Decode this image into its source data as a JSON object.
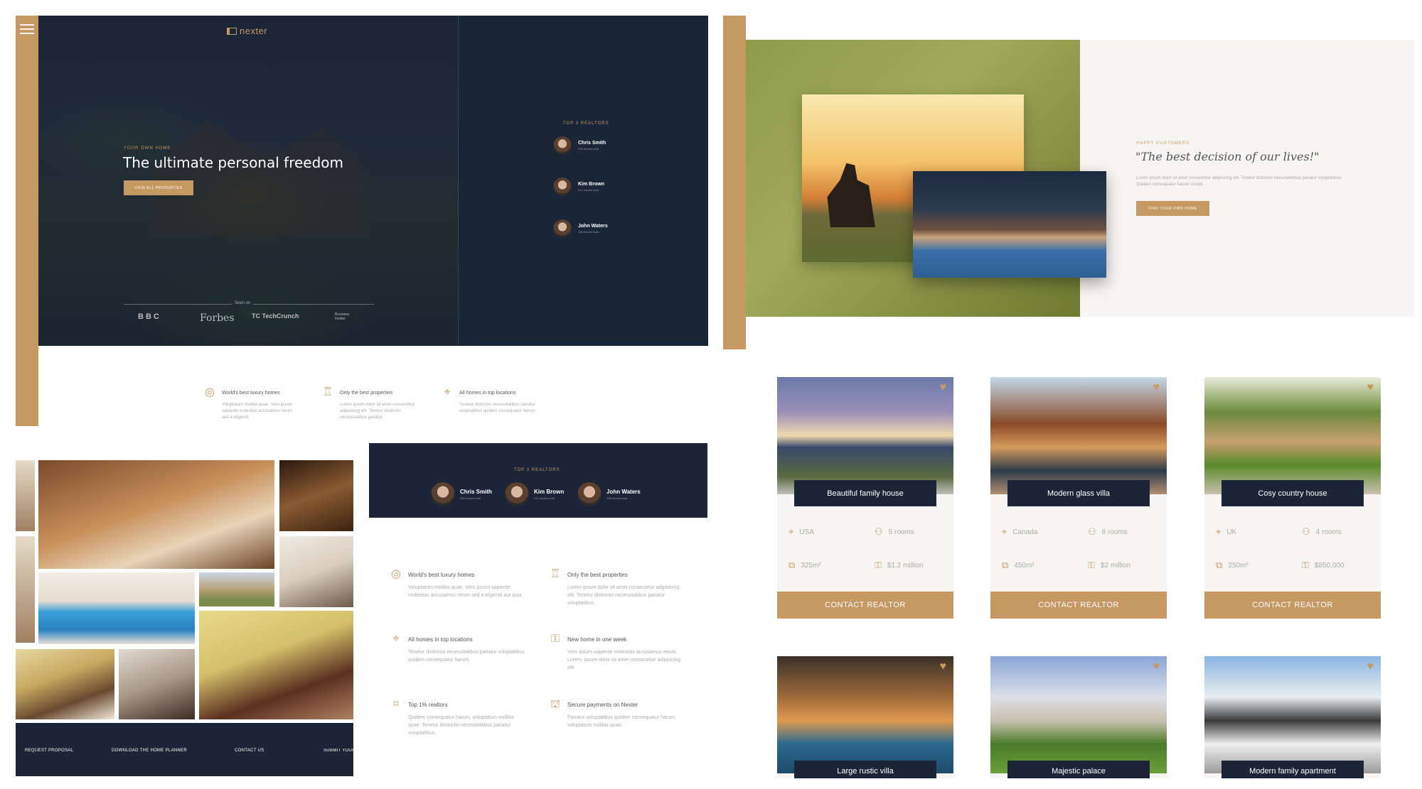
{
  "hero": {
    "logo": "nexter",
    "eyebrow": "Your own home",
    "title": "The ultimate personal freedom",
    "cta": "View all properties",
    "seen_on": "Seen on",
    "brands": [
      "BBC",
      "Forbes",
      "TechCrunch",
      "Business Insider"
    ]
  },
  "realtors": {
    "heading": "Top 3 Realtors",
    "people": [
      {
        "name": "Chris Smith",
        "sub": "245 houses sold"
      },
      {
        "name": "Kim Brown",
        "sub": "212 houses sold"
      },
      {
        "name": "John Waters",
        "sub": "198 houses sold"
      }
    ]
  },
  "features_row": [
    {
      "icon": "globe-icon",
      "title": "World's best luxury homes",
      "text": "Voluptatum mollitia quae. Vero ipsum sapiente molestias accusamus rerum sed a eligendi."
    },
    {
      "icon": "trophy-icon",
      "title": "Only the best properties",
      "text": "Lorem ipsum dolor sit amet consectetur adipisicing elit. Tenetur distinctio necessitatibus pariatur."
    },
    {
      "icon": "map-pin-icon",
      "title": "All homes in top locations",
      "text": "Tenetur distinctio necessitatibus pariatur voluptatibus quidem consequatur harum."
    }
  ],
  "testimonial": {
    "eyebrow": "Happy customers",
    "quote": "\"The best decision of our lives!\"",
    "text": "Lorem ipsum dolor sit amet consectetur adipisicing elit. Tenetur distinctio necessitatibus pariatur voluptatibus. Quidem consequatur harum volupti.",
    "cta": "Find your own home"
  },
  "features_grid": [
    {
      "icon": "globe-icon",
      "title": "World's best luxury homes",
      "text": "Voluptatum mollitia quae. Vero ipsum sapiente molestias accusamus rerum sed a eligendi aut quia."
    },
    {
      "icon": "trophy-icon",
      "title": "Only the best properties",
      "text": "Lorem ipsum dolor sit amet consectetur adipisicing elit. Tenetur distinctio necessitatibus pariatur voluptatibus."
    },
    {
      "icon": "map-pin-icon",
      "title": "All homes in top locations",
      "text": "Tenetur distinctio necessitatibus pariatur voluptatibus quidem consequatur harum."
    },
    {
      "icon": "key-icon",
      "title": "New home in one week",
      "text": "Vero ipsum sapiente molestias accusamus rerum. Lorem, ipsum dolor sit amet consectetur adipisicing elit."
    },
    {
      "icon": "chart-icon",
      "title": "Top 1% realtors",
      "text": "Quidem consequatur harum, voluptatum mollitia quae. Tenetur distinctio necessitatibus pariatur voluptatibus."
    },
    {
      "icon": "basket-icon",
      "title": "Secure payments on Nexter",
      "text": "Pariatur voluptatibus quidem consequatur harum, voluptatum mollitia quae."
    }
  ],
  "footer_links": [
    "Request proposal",
    "Download the home planner",
    "Contact us",
    "Submit your p"
  ],
  "cards": [
    {
      "title": "Beautiful family house",
      "country": "USA",
      "rooms": "5 rooms",
      "area": "325m²",
      "price": "$1.2 million",
      "cta": "Contact realtor"
    },
    {
      "title": "Modern glass villa",
      "country": "Canada",
      "rooms": "6 rooms",
      "area": "450m²",
      "price": "$2 million",
      "cta": "Contact realtor"
    },
    {
      "title": "Cosy country house",
      "country": "UK",
      "rooms": "4 rooms",
      "area": "250m²",
      "price": "$850,000",
      "cta": "Contact realtor"
    },
    {
      "title": "Large rustic villa"
    },
    {
      "title": "Majestic palace"
    },
    {
      "title": "Modern family apartment"
    }
  ],
  "colors": {
    "accent": "#c69963",
    "navy": "#1b2537"
  }
}
